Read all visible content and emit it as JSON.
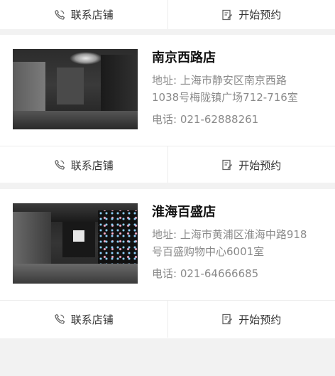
{
  "prev_card": {
    "contact_label": "联系店铺",
    "reserve_label": "开始预约"
  },
  "stores": [
    {
      "name": "南京西路店",
      "address": "地址: 上海市静安区南京西路1038号梅陇镇广场712-716室",
      "phone": "电话: 021-62888261",
      "contact_label": "联系店铺",
      "reserve_label": "开始预约"
    },
    {
      "name": "淮海百盛店",
      "address": "地址: 上海市黄浦区淮海中路918号百盛购物中心6001室",
      "phone": "电话: 021-64666685",
      "contact_label": "联系店铺",
      "reserve_label": "开始预约"
    }
  ],
  "icons": {
    "contact": "phone-icon",
    "reserve": "edit-note-icon"
  }
}
